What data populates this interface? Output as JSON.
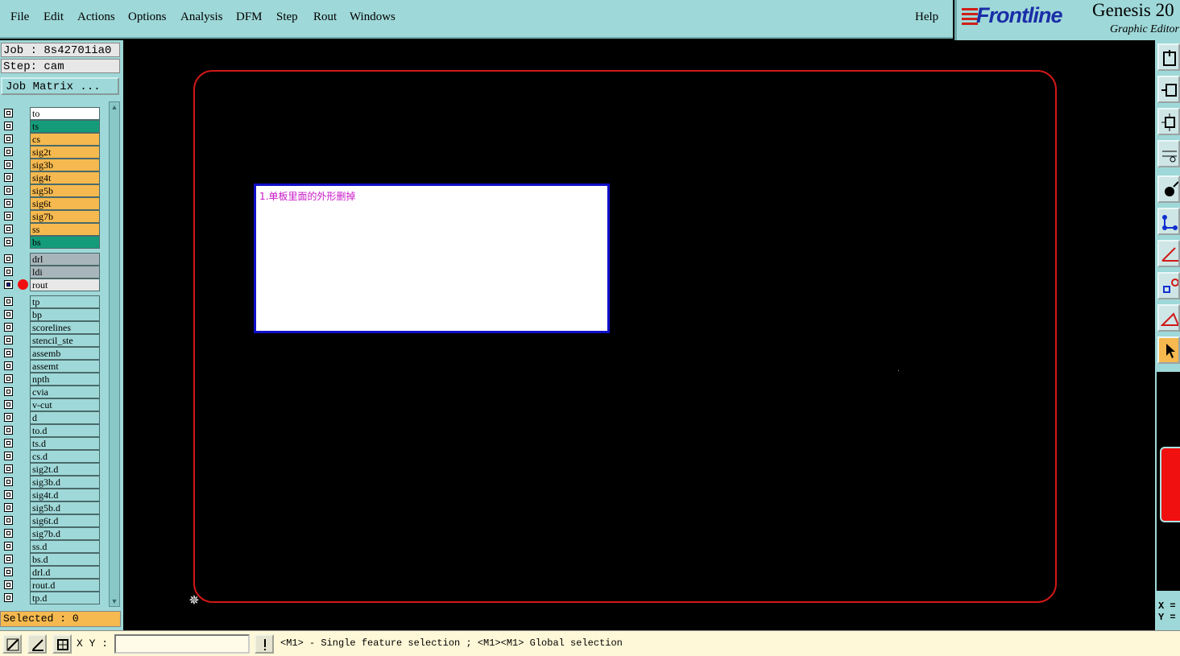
{
  "menubar": {
    "items": [
      "File",
      "Edit",
      "Actions",
      "Options",
      "Analysis",
      "DFM",
      "Step",
      "Rout",
      "Windows"
    ],
    "help": "Help"
  },
  "brand": {
    "logo": "Frontline",
    "product": "Genesis 20",
    "subtitle": "Graphic Editor"
  },
  "job": {
    "job_line": "Job : 8s42701ia0",
    "step_line": "Step: cam",
    "job_matrix_button": "Job Matrix ..."
  },
  "layers": [
    {
      "name": "to",
      "color": "#ffffff"
    },
    {
      "name": "ts",
      "color": "#149b7a"
    },
    {
      "name": "cs",
      "color": "#f5b94f"
    },
    {
      "name": "sig2t",
      "color": "#f5b94f"
    },
    {
      "name": "sig3b",
      "color": "#f5b94f"
    },
    {
      "name": "sig4t",
      "color": "#f5b94f"
    },
    {
      "name": "sig5b",
      "color": "#f5b94f"
    },
    {
      "name": "sig6t",
      "color": "#f5b94f"
    },
    {
      "name": "sig7b",
      "color": "#f5b94f"
    },
    {
      "name": "ss",
      "color": "#f5b94f"
    },
    {
      "name": "bs",
      "color": "#149b7a"
    },
    {
      "name": "drl",
      "color": "#a8b6bc"
    },
    {
      "name": "ldi",
      "color": "#a8b6bc"
    },
    {
      "name": "rout",
      "color": "#e8e8e8",
      "active": true
    },
    {
      "name": "tp",
      "color": "#9fd8d8"
    },
    {
      "name": "bp",
      "color": "#9fd8d8"
    },
    {
      "name": "scorelines",
      "color": "#9fd8d8"
    },
    {
      "name": "stencil_ste",
      "color": "#9fd8d8"
    },
    {
      "name": "assemb",
      "color": "#9fd8d8"
    },
    {
      "name": "assemt",
      "color": "#9fd8d8"
    },
    {
      "name": "npth",
      "color": "#9fd8d8"
    },
    {
      "name": "cvia",
      "color": "#9fd8d8"
    },
    {
      "name": "v-cut",
      "color": "#9fd8d8"
    },
    {
      "name": "d",
      "color": "#9fd8d8"
    },
    {
      "name": "to.d",
      "color": "#9fd8d8"
    },
    {
      "name": "ts.d",
      "color": "#9fd8d8"
    },
    {
      "name": "cs.d",
      "color": "#9fd8d8"
    },
    {
      "name": "sig2t.d",
      "color": "#9fd8d8"
    },
    {
      "name": "sig3b.d",
      "color": "#9fd8d8"
    },
    {
      "name": "sig4t.d",
      "color": "#9fd8d8"
    },
    {
      "name": "sig5b.d",
      "color": "#9fd8d8"
    },
    {
      "name": "sig6t.d",
      "color": "#9fd8d8"
    },
    {
      "name": "sig7b.d",
      "color": "#9fd8d8"
    },
    {
      "name": "ss.d",
      "color": "#9fd8d8"
    },
    {
      "name": "bs.d",
      "color": "#9fd8d8"
    },
    {
      "name": "drl.d",
      "color": "#9fd8d8"
    },
    {
      "name": "rout.d",
      "color": "#9fd8d8"
    },
    {
      "name": "tp.d",
      "color": "#9fd8d8"
    }
  ],
  "selected": "Selected : 0",
  "note": {
    "text": "1.单板里面的外形删掉"
  },
  "coords": {
    "x_label": "X =",
    "y_label": "Y ="
  },
  "statusbar": {
    "xy_label": "X Y :",
    "xy_value": "",
    "message": "<M1> - Single feature selection ; <M1><M1> Global selection"
  },
  "colors": {
    "profile": "#d01818",
    "note_border": "#1010c8",
    "note_text": "#c818c8",
    "panel_bg": "#9fd8d8"
  }
}
